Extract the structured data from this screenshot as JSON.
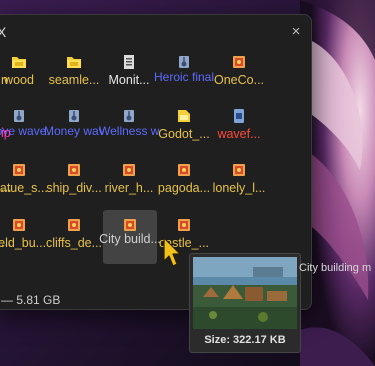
{
  "window": {
    "title_fragment": "X",
    "close_glyph": "×"
  },
  "row1": [
    {
      "name": "wood",
      "style": "yellow"
    },
    {
      "name": "seamle...",
      "style": "yellow"
    },
    {
      "name": "Monit...",
      "style": "white"
    },
    {
      "name": "Heroic final m...",
      "style": "blue"
    },
    {
      "name": "OneCo...",
      "style": "yellow"
    }
  ],
  "row2": [
    {
      "name": "Love wave...",
      "style": "blue"
    },
    {
      "name": "Money wave...",
      "style": "blue"
    },
    {
      "name": "Wellness wave...",
      "style": "blue"
    },
    {
      "name": "Godot_...",
      "style": "yellow"
    },
    {
      "name": "wavef...",
      "style": "red"
    }
  ],
  "row3": [
    {
      "name": "statue_s...",
      "style": "yellow"
    },
    {
      "name": "ship_div...",
      "style": "yellow"
    },
    {
      "name": "river_h...",
      "style": "yellow"
    },
    {
      "name": "pagoda...",
      "style": "yellow"
    },
    {
      "name": "lonely_l...",
      "style": "yellow"
    }
  ],
  "row4": [
    {
      "name": "field_bu...",
      "style": "yellow"
    },
    {
      "name": "cliffs_de...",
      "style": "yellow"
    },
    {
      "name": "City build...",
      "style": "sel"
    },
    {
      "name": "castle_...",
      "style": "yellow"
    }
  ],
  "cut_labels": {
    "r1": "n",
    "r2": "ip",
    "r3": "...",
    "r4": "..."
  },
  "status": {
    "text": "— 5.81 GB"
  },
  "preview": {
    "size_label": "Size: 322.17 KB",
    "hover_title": "City building m"
  },
  "colors": {
    "folder_yellow": "#e6c24a",
    "link_blue": "#5b6bff",
    "error_red": "#ff4a3a",
    "magenta": "#ff3cbe"
  }
}
